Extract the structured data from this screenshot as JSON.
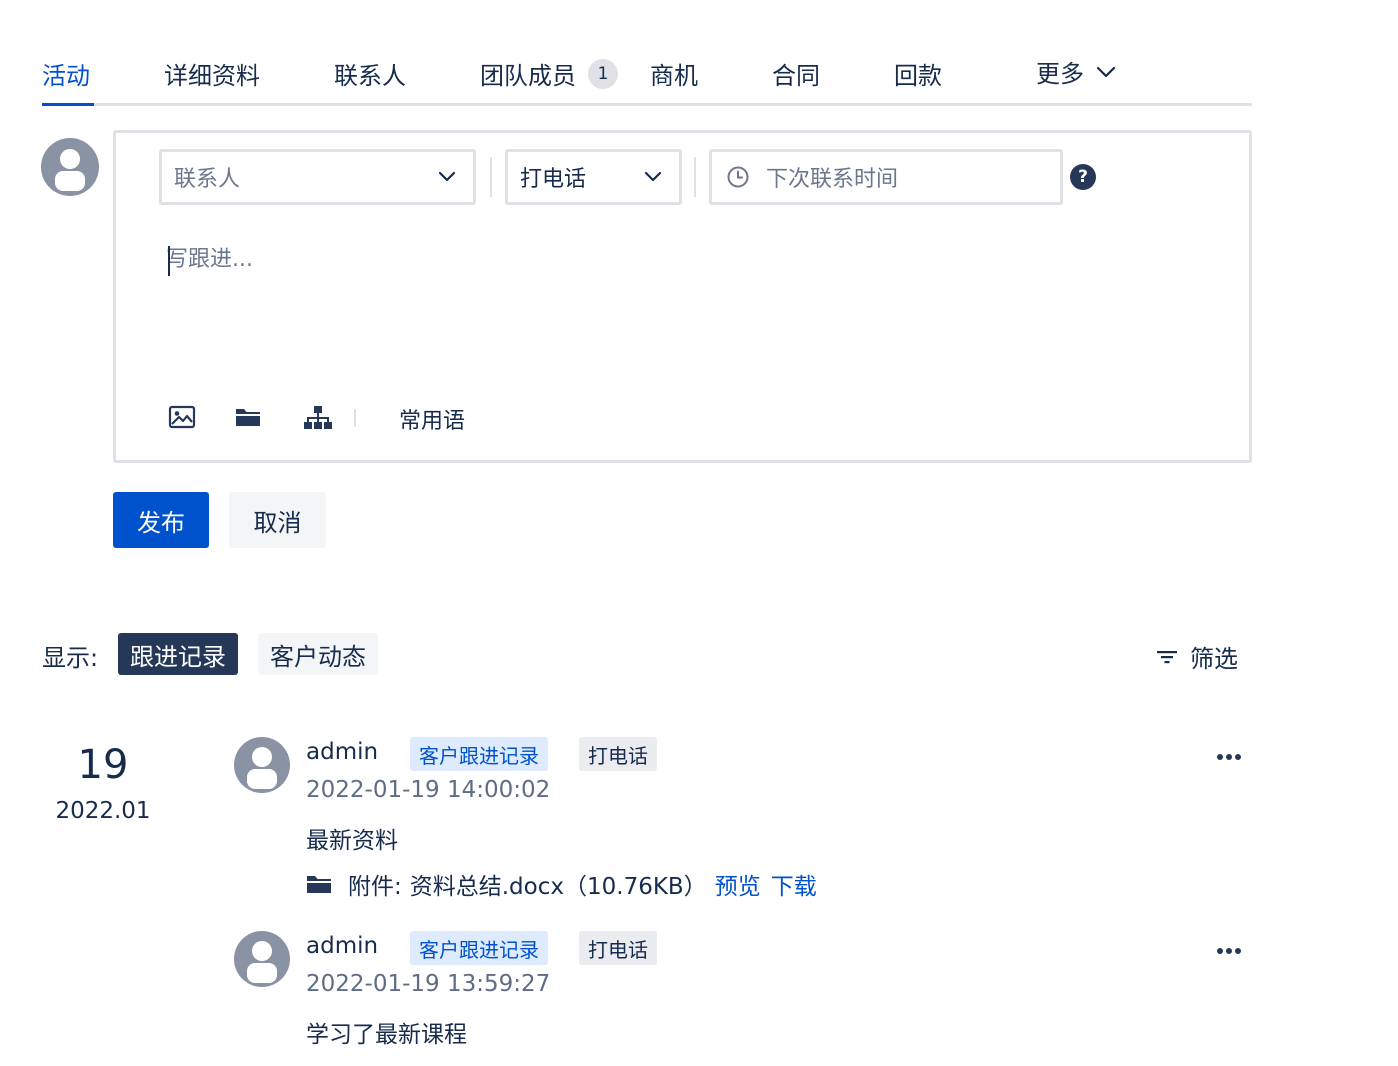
{
  "tabs": [
    {
      "label": "活动",
      "active": true
    },
    {
      "label": "详细资料"
    },
    {
      "label": "联系人"
    },
    {
      "label": "团队成员",
      "badge": "1"
    },
    {
      "label": "商机"
    },
    {
      "label": "合同"
    },
    {
      "label": "回款"
    },
    {
      "label": "更多"
    }
  ],
  "editor": {
    "contact_placeholder": "联系人",
    "type_value": "打电话",
    "next_time_placeholder": "下次联系时间",
    "help_symbol": "?",
    "textarea_placeholder": "写跟进...",
    "common_phrases": "常用语"
  },
  "actions": {
    "publish": "发布",
    "cancel": "取消"
  },
  "filter_bar": {
    "show_label": "显示:",
    "options": [
      {
        "label": "跟进记录",
        "selected": true
      },
      {
        "label": "客户动态"
      }
    ],
    "filter_label": "筛选"
  },
  "timeline": {
    "day": "19",
    "year_month": "2022.01",
    "entries": [
      {
        "user": "admin",
        "tag_record": "客户跟进记录",
        "tag_type": "打电话",
        "time": "2022-01-19 14:00:02",
        "content": "最新资料",
        "attachment": {
          "label": "附件:",
          "file": "资料总结.docx（10.76KB）",
          "preview": "预览",
          "download": "下载"
        }
      },
      {
        "user": "admin",
        "tag_record": "客户跟进记录",
        "tag_type": "打电话",
        "time": "2022-01-19 13:59:27",
        "content": "学习了最新课程"
      }
    ]
  },
  "colors": {
    "primary": "#0052cc",
    "text": "#172b4d",
    "muted": "#6b778c",
    "border": "#dfe1e6",
    "dark": "#253858"
  }
}
